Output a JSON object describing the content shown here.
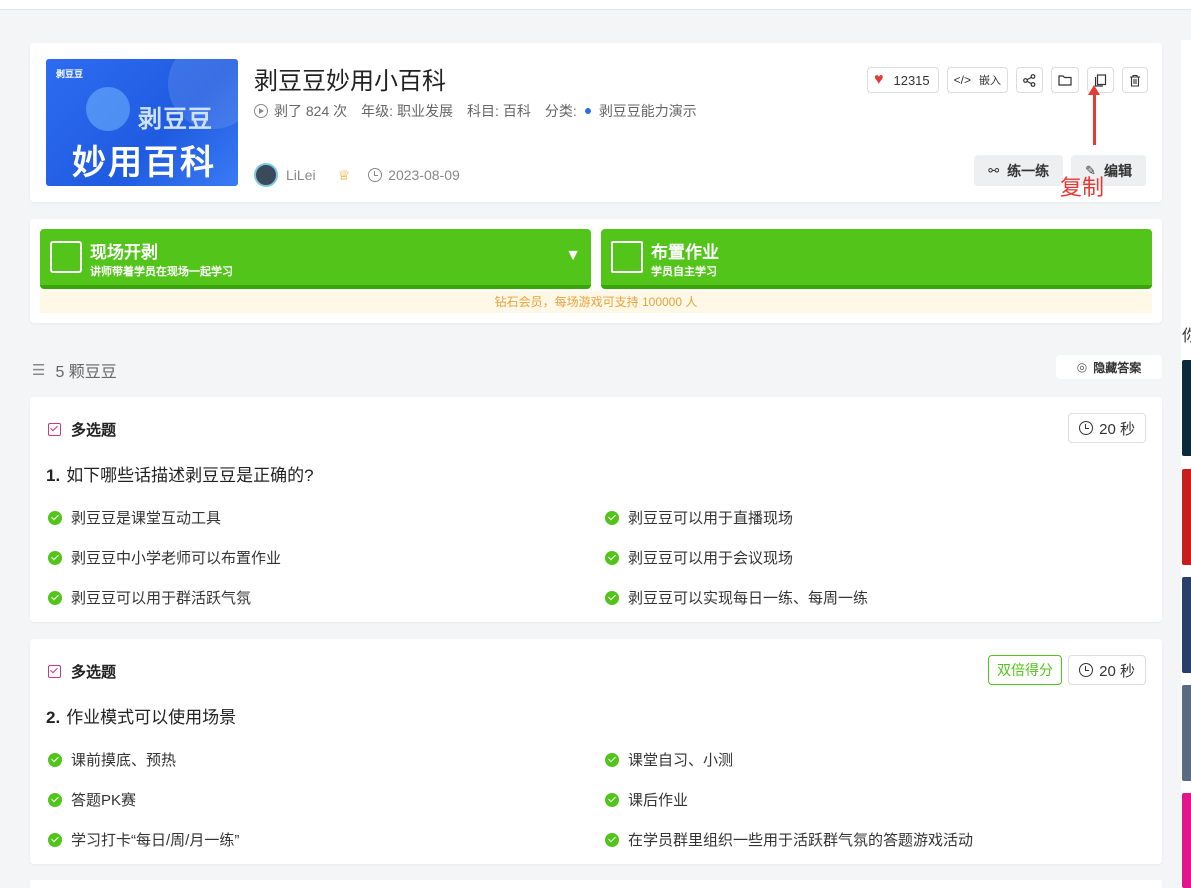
{
  "header": {
    "cover": {
      "brand": "剥豆豆",
      "line1": "剥豆豆",
      "line2": "妙用百科"
    },
    "title": "剥豆豆妙用小百科",
    "meta": {
      "plays": "剥了 824 次",
      "grade_label": "年级:",
      "grade": "职业发展",
      "subject_label": "科目:",
      "subject": "百科",
      "category_label": "分类:",
      "category": "剥豆豆能力演示"
    },
    "author": "LiLei",
    "date": "2023-08-09",
    "likes": "12315",
    "embed_code": "</>",
    "embed_label": "嵌入",
    "practice_label": "练一练",
    "edit_label": "编辑"
  },
  "annotation": {
    "text": "复制"
  },
  "play": {
    "live": {
      "title": "现场开剥",
      "subtitle": "讲师带着学员在现场一起学习"
    },
    "homework": {
      "title": "布置作业",
      "subtitle": "学员自主学习"
    },
    "notice": "钻石会员，每场游戏可支持 100000 人"
  },
  "list": {
    "count_label": "5 颗豆豆",
    "hide_answers": "隐藏答案"
  },
  "questions": [
    {
      "type": "多选题",
      "timer": "20 秒",
      "number": "1.",
      "text": "如下哪些话描述剥豆豆是正确的?",
      "options": [
        "剥豆豆是课堂互动工具",
        "剥豆豆可以用于直播现场",
        "剥豆豆中小学老师可以布置作业",
        "剥豆豆可以用于会议现场",
        "剥豆豆可以用于群活跃气氛",
        "剥豆豆可以实现每日一练、每周一练"
      ]
    },
    {
      "type": "多选题",
      "timer": "20 秒",
      "badge": "双倍得分",
      "number": "2.",
      "text": "作业模式可以使用场景",
      "options": [
        "课前摸底、预热",
        "课堂自习、小测",
        "答题PK赛",
        "课后作业",
        "学习打卡“每日/周/月一练”",
        "在学员群里组织一些用于活跃群气氛的答题游戏活动"
      ]
    }
  ],
  "sidebar": {
    "heading": "你"
  },
  "colors": {
    "green": "#52c41a",
    "accent_red": "#e53935",
    "pink": "#d0367c",
    "blue": "#2d6cf0"
  }
}
